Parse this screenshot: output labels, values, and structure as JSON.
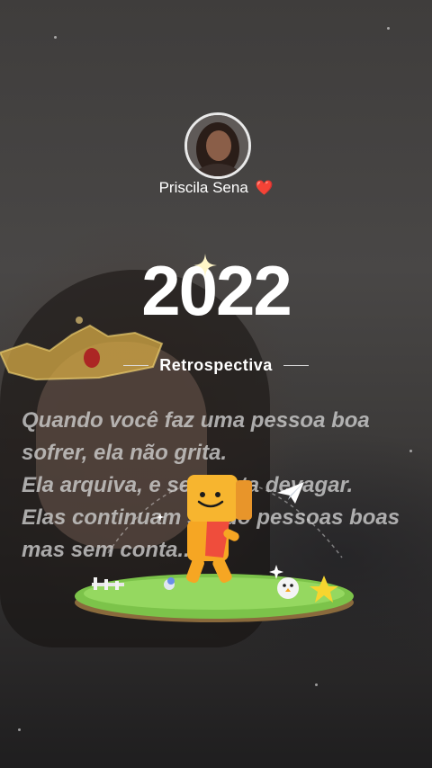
{
  "profile": {
    "name": "Priscila Sena",
    "heart_emoji": "❤️"
  },
  "hero": {
    "year": "2022",
    "subtitle": "Retrospectiva"
  },
  "quote": {
    "lines": [
      "Quando você faz uma pessoa boa",
      "sofrer, ela não grita.",
      "Ela arquiva, e se afasta devagar.",
      "Elas continuam sendo pessoas boas",
      "mas sem conta..."
    ]
  },
  "colors": {
    "accent_heart": "#e0202e",
    "mascot": "#f6a623",
    "grass": "#7cc34a"
  }
}
